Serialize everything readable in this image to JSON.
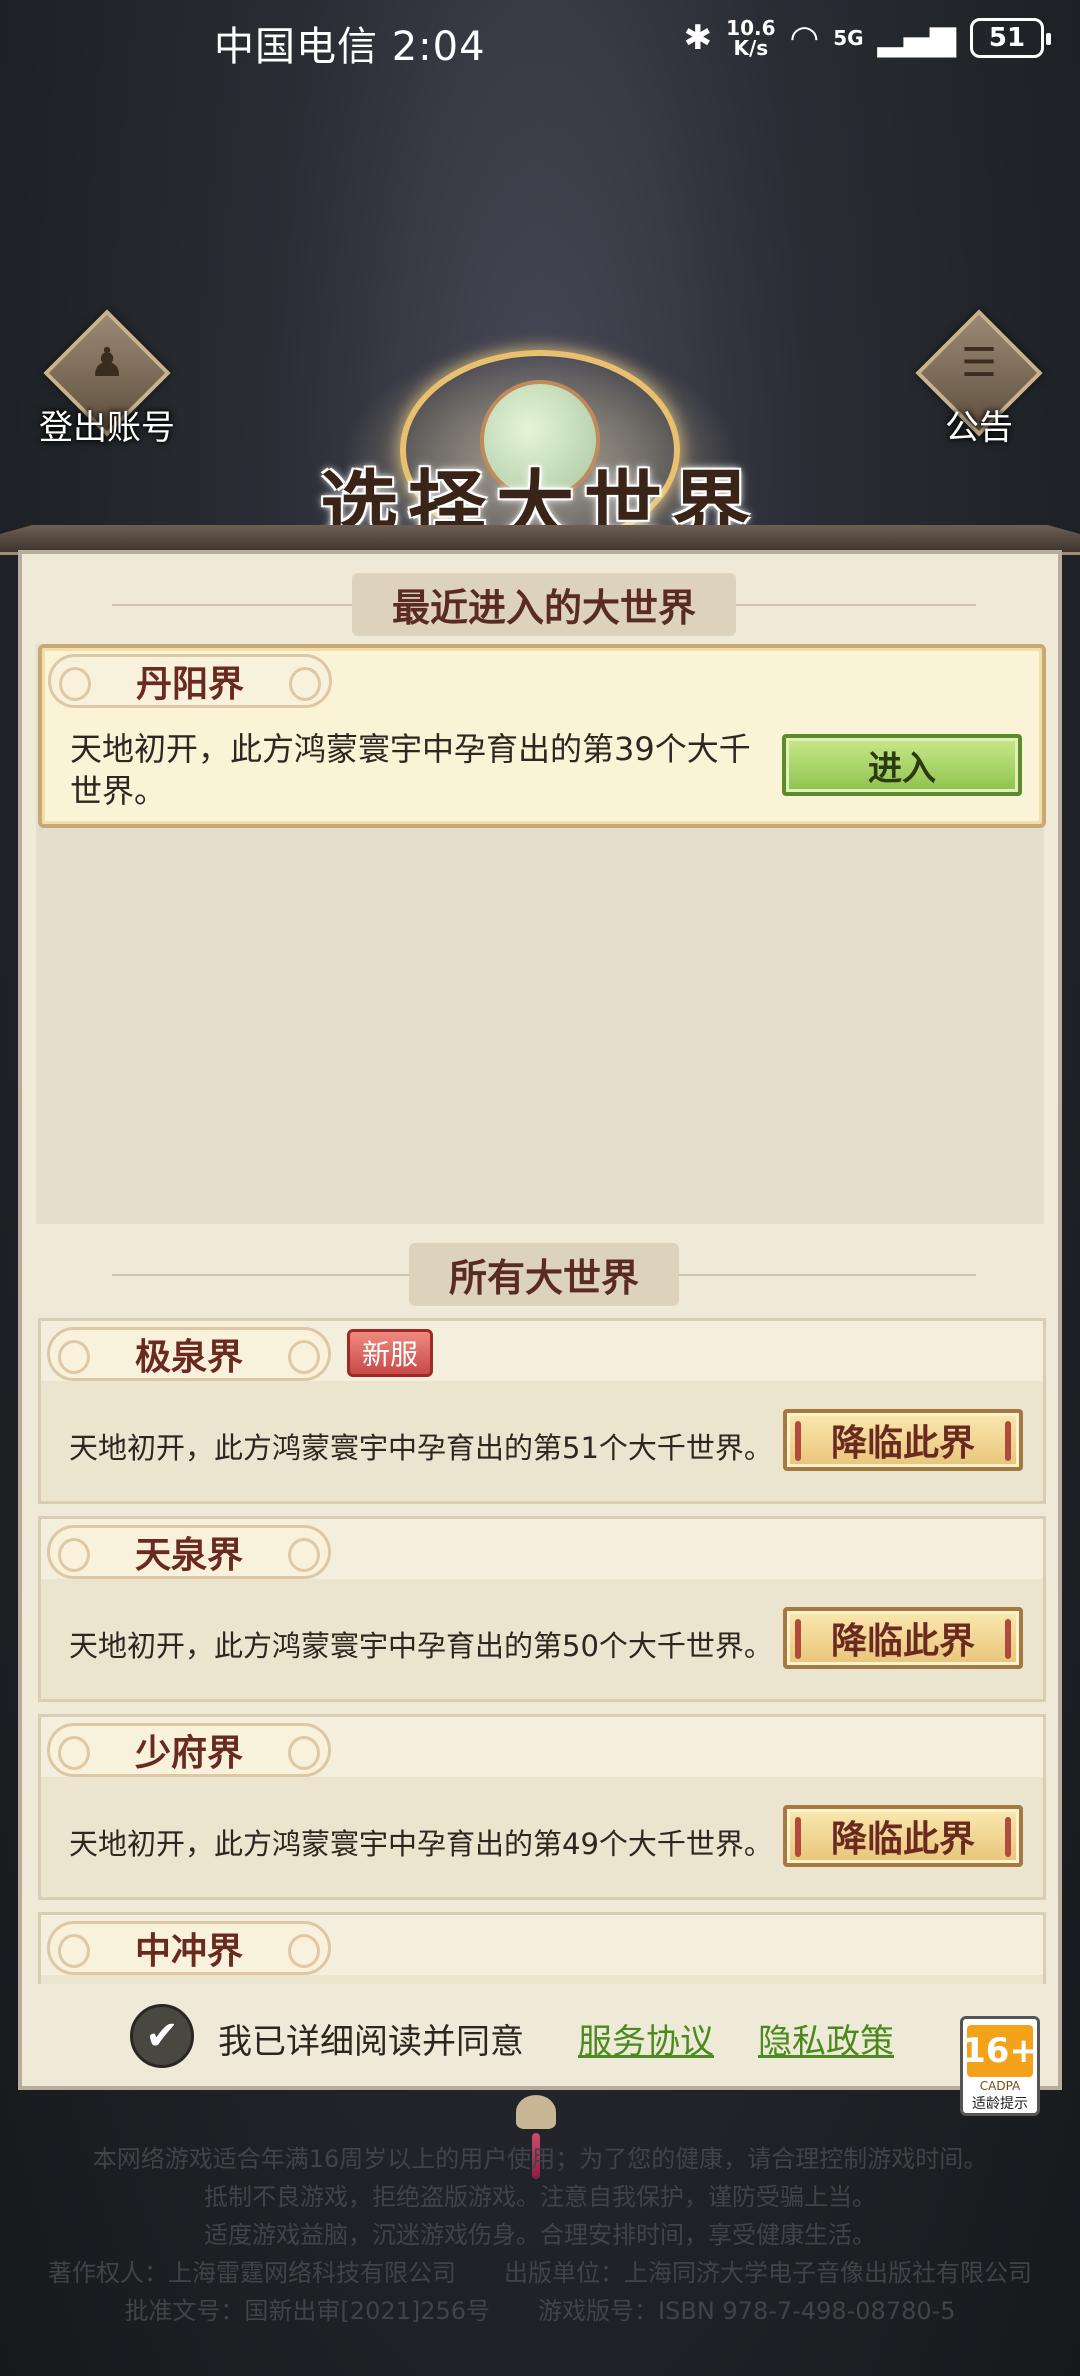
{
  "status_bar": {
    "carrier_time": "中国电信 2:04",
    "net_speed_value": "10.6",
    "net_speed_unit": "K/s",
    "network": "5G",
    "battery": "51"
  },
  "header": {
    "logout_label": "登出账号",
    "notice_label": "公告",
    "page_title": "选择大世界"
  },
  "recent_section": {
    "title": "最近进入的大世界",
    "world": {
      "name": "丹阳界",
      "description": "天地初开，此方鸿蒙寰宇中孕育出的第39个大千世界。",
      "button": "进入"
    }
  },
  "all_section": {
    "title": "所有大世界",
    "worlds": [
      {
        "name": "极泉界",
        "badge": "新服",
        "description": "天地初开，此方鸿蒙寰宇中孕育出的第51个大千世界。",
        "button": "降临此界"
      },
      {
        "name": "天泉界",
        "description": "天地初开，此方鸿蒙寰宇中孕育出的第50个大千世界。",
        "button": "降临此界"
      },
      {
        "name": "少府界",
        "description": "天地初开，此方鸿蒙寰宇中孕育出的第49个大千世界。",
        "button": "降临此界"
      },
      {
        "name": "中冲界"
      }
    ]
  },
  "agreement": {
    "text": "我已详细阅读并同意",
    "tos_link": "服务协议",
    "privacy_link": "隐私政策",
    "checked": true
  },
  "age_rating": {
    "rating": "16+",
    "org": "CADPA",
    "tip": "适龄提示"
  },
  "footer": {
    "line1": "本网络游戏适合年满16周岁以上的用户使用；为了您的健康，请合理控制游戏时间。",
    "line2": "抵制不良游戏，拒绝盗版游戏。注意自我保护，谨防受骗上当。",
    "line3": "适度游戏益脑，沉迷游戏伤身。合理安排时间，享受健康生活。",
    "line4": "著作权人：上海雷霆网络科技有限公司　　出版单位：上海同济大学电子音像出版社有限公司",
    "line5": "批准文号：国新出审[2021]256号　　游戏版号：ISBN 978-7-498-08780-5"
  }
}
